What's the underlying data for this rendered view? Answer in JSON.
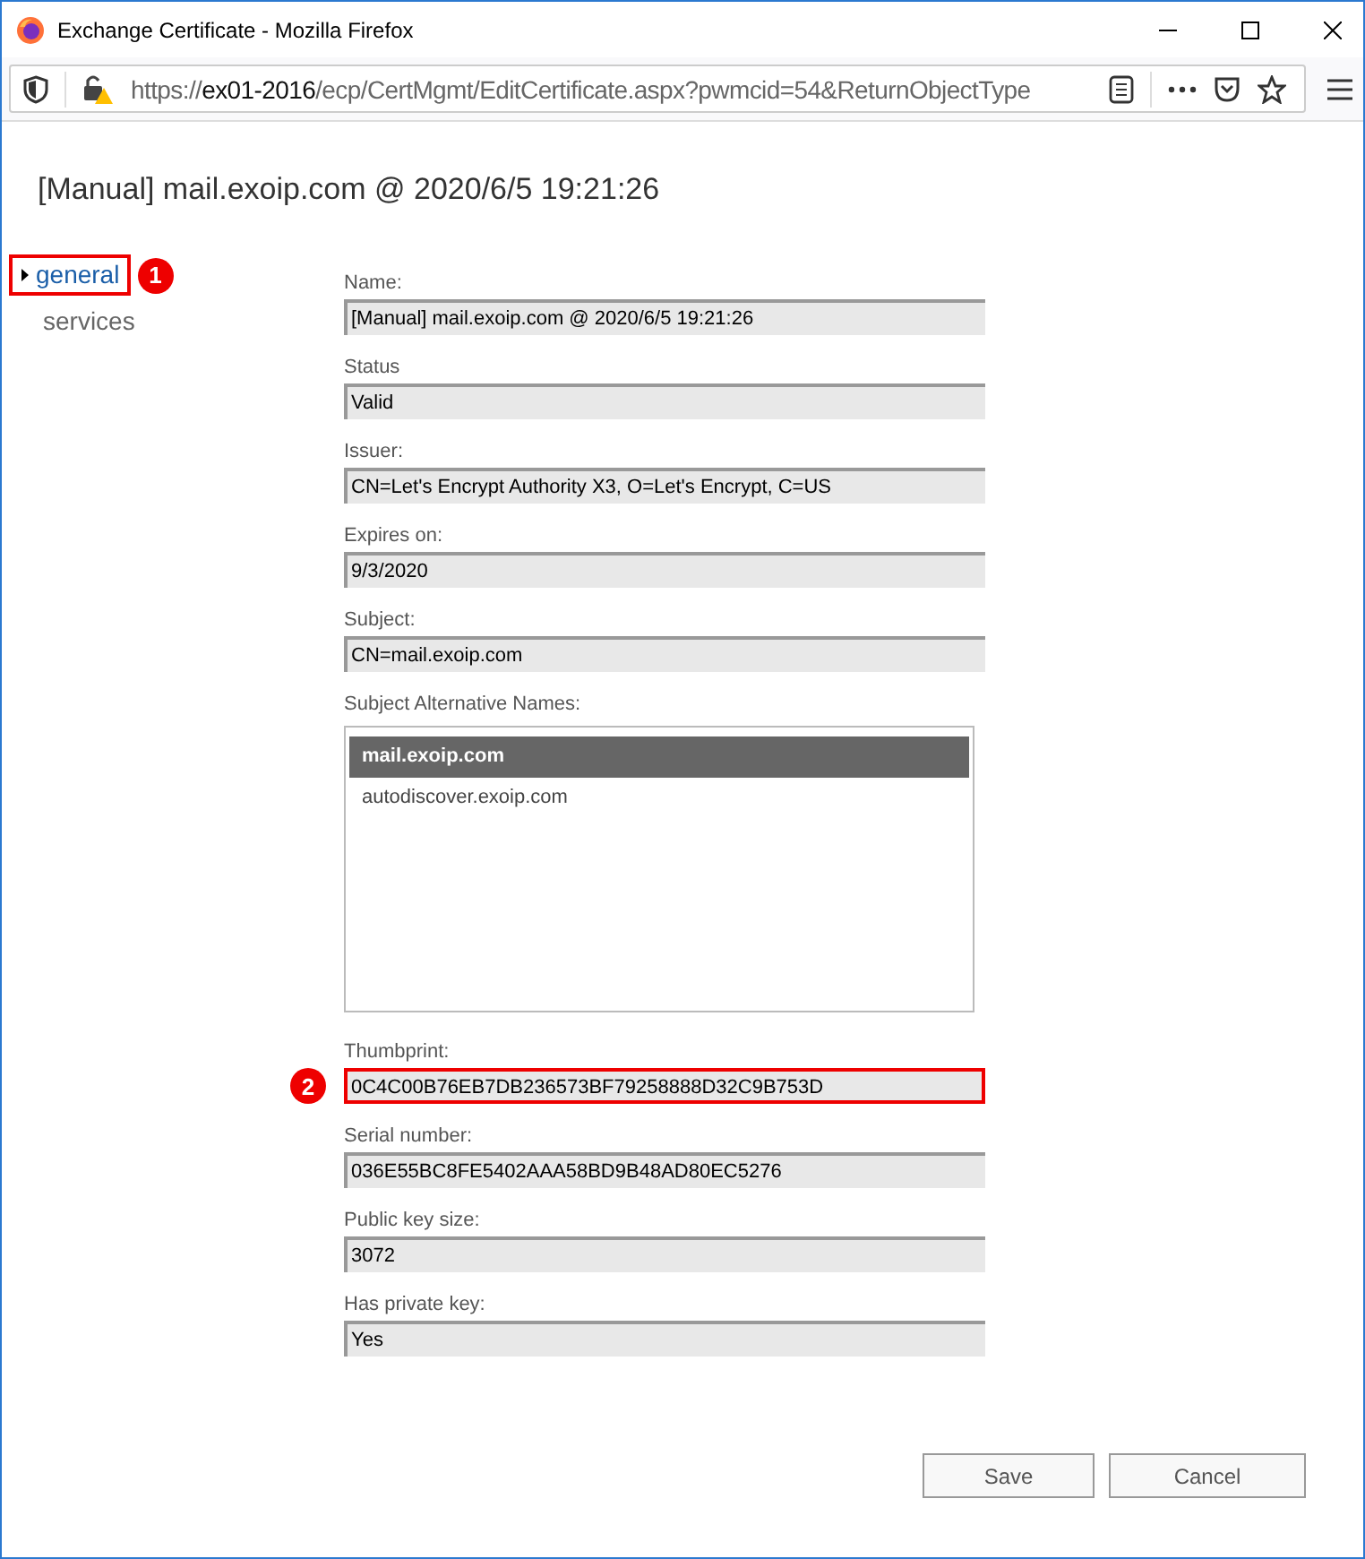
{
  "window": {
    "title": "Exchange Certificate - Mozilla Firefox"
  },
  "address_bar": {
    "url_prefix": "https://",
    "url_host": "ex01-2016",
    "url_path": "/ecp/CertMgmt/EditCertificate.aspx?pwmcid=54&ReturnObjectType"
  },
  "page_title": "[Manual] mail.exoip.com @ 2020/6/5 19:21:26",
  "nav": [
    {
      "label": "general",
      "selected": true,
      "highlighted": true,
      "badge": "1"
    },
    {
      "label": "services",
      "selected": false,
      "highlighted": false
    }
  ],
  "fields": [
    {
      "kind": "text",
      "label": "Name:",
      "value": "[Manual] mail.exoip.com @ 2020/6/5 19:21:26",
      "highlighted": false
    },
    {
      "kind": "text",
      "label": "Status",
      "value": "Valid",
      "highlighted": false
    },
    {
      "kind": "text",
      "label": "Issuer:",
      "value": "CN=Let's Encrypt Authority X3, O=Let's Encrypt, C=US",
      "highlighted": false
    },
    {
      "kind": "text",
      "label": "Expires on:",
      "value": "9/3/2020",
      "highlighted": false
    },
    {
      "kind": "text",
      "label": "Subject:",
      "value": "CN=mail.exoip.com",
      "highlighted": false
    },
    {
      "kind": "list",
      "label": "Subject Alternative Names:",
      "items": [
        {
          "text": "mail.exoip.com",
          "selected": true
        },
        {
          "text": "autodiscover.exoip.com",
          "selected": false
        }
      ]
    },
    {
      "kind": "text",
      "label": "Thumbprint:",
      "value": "0C4C00B76EB7DB236573BF79258888D32C9B753D",
      "highlighted": true,
      "badge": "2"
    },
    {
      "kind": "text",
      "label": "Serial number:",
      "value": "036E55BC8FE5402AAA58BD9B48AD80EC5276",
      "highlighted": false
    },
    {
      "kind": "text",
      "label": "Public key size:",
      "value": "3072",
      "highlighted": false
    },
    {
      "kind": "text",
      "label": "Has private key:",
      "value": "Yes",
      "highlighted": false
    }
  ],
  "buttons": [
    "Save",
    "Cancel"
  ]
}
